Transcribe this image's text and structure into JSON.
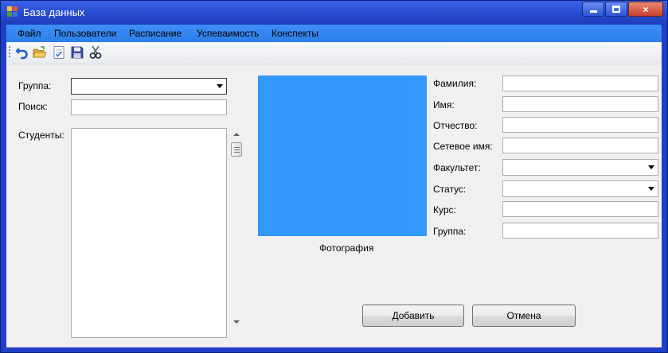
{
  "window": {
    "title": "База данных",
    "controls": {
      "minimize": "minimize-button",
      "maximize": "maximize-button",
      "close": "×"
    }
  },
  "menu": {
    "items": [
      "Файл",
      "Пользователи",
      "Расписание",
      "Успеваимость",
      "Конспекты"
    ]
  },
  "toolbar": {
    "icons": [
      "undo-icon",
      "open-folder-icon",
      "checklist-icon",
      "save-icon",
      "cut-icon"
    ]
  },
  "left": {
    "group_label": "Группа:",
    "group_value": "",
    "search_label": "Поиск:",
    "search_value": "",
    "students_label": "Студенты:",
    "students": []
  },
  "photo": {
    "caption": "Фотография",
    "color": "#3399ff"
  },
  "form": {
    "fields": [
      {
        "label": "Фамилия:",
        "value": "",
        "type": "text"
      },
      {
        "label": "Имя:",
        "value": "",
        "type": "text"
      },
      {
        "label": "Отчество:",
        "value": "",
        "type": "text"
      },
      {
        "label": "Сетевое имя:",
        "value": "",
        "type": "text"
      },
      {
        "label": "Факультет:",
        "value": "",
        "type": "combo"
      },
      {
        "label": "Статус:",
        "value": "",
        "type": "combo"
      },
      {
        "label": "Курс:",
        "value": "",
        "type": "text"
      },
      {
        "label": "Группа:",
        "value": "",
        "type": "text"
      }
    ]
  },
  "actions": {
    "add_label": "Добавить",
    "cancel_label": "Отмена"
  },
  "colors": {
    "title_bar": "#2a4fd4",
    "menu_bar": "#3388f0",
    "client_bg": "#f0f0f0",
    "photo": "#3399ff"
  }
}
